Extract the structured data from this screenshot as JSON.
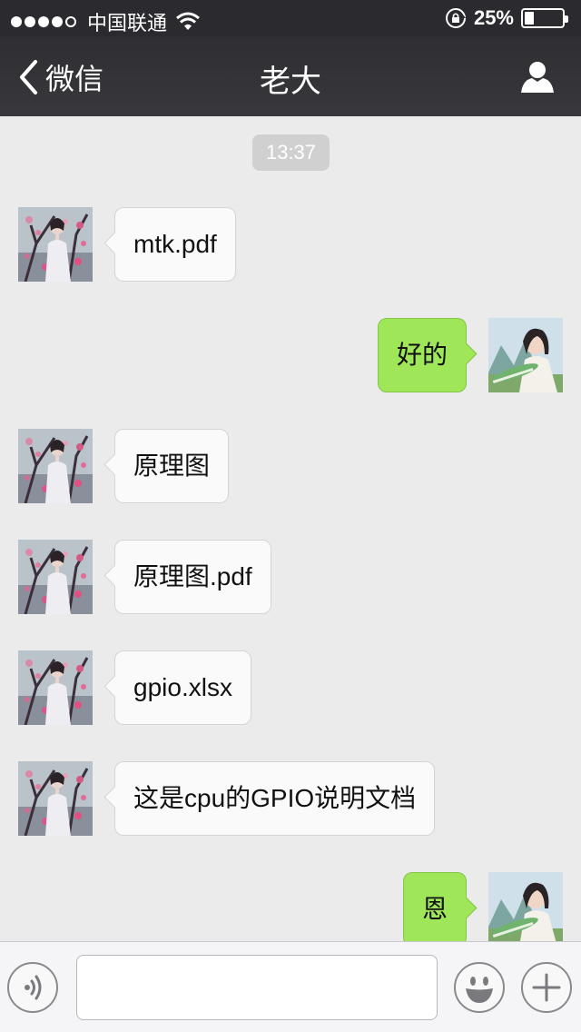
{
  "status_bar": {
    "signal_dots_filled": 4,
    "signal_dots_total": 5,
    "carrier": "中国联通",
    "battery_text": "25%",
    "battery_level": 0.25
  },
  "nav": {
    "back_label": "微信",
    "title": "老大",
    "right_icon": "profile-icon"
  },
  "chat": {
    "timestamp": "13:37",
    "messages": [
      {
        "side": "left",
        "text": "mtk.pdf"
      },
      {
        "side": "right",
        "text": "好的"
      },
      {
        "side": "left",
        "text": "原理图"
      },
      {
        "side": "left",
        "text": "原理图.pdf"
      },
      {
        "side": "left",
        "text": "gpio.xlsx"
      },
      {
        "side": "left",
        "text": "这是cpu的GPIO说明文档"
      },
      {
        "side": "right",
        "text": "恩"
      }
    ]
  },
  "input_bar": {
    "voice_icon": "voice-icon",
    "input_value": "",
    "emoji_icon": "emoji-icon",
    "plus_icon": "plus-icon"
  },
  "colors": {
    "nav_bg": "#333337",
    "chat_bg": "#ebebeb",
    "bubble_sent": "#9fe658",
    "bubble_received": "#fafafa"
  }
}
